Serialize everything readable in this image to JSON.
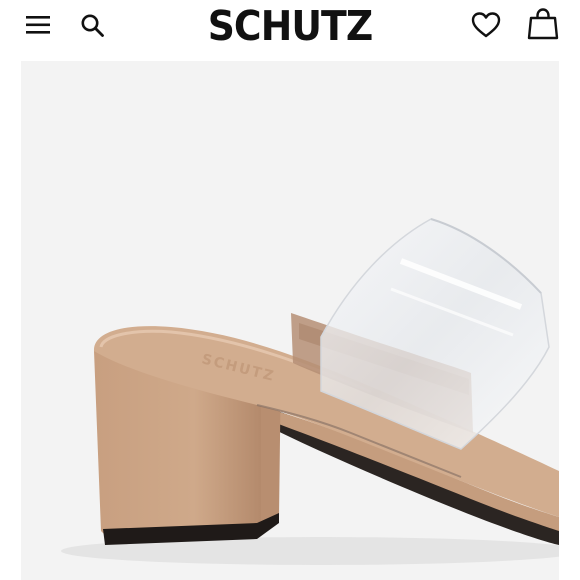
{
  "header": {
    "brand": "SCHUTZ",
    "icons": {
      "menu": "hamburger-menu-icon",
      "search": "search-icon",
      "wishlist": "heart-icon",
      "cart": "shopping-bag-icon"
    }
  },
  "product": {
    "image": {
      "subject": "clear-strap-block-heel-mule",
      "insole_brand_stamp": "SCHUTZ",
      "colors": {
        "background": "#f3f3f3",
        "suede": "#caa384",
        "vinyl": "#e7e9ec"
      }
    }
  }
}
